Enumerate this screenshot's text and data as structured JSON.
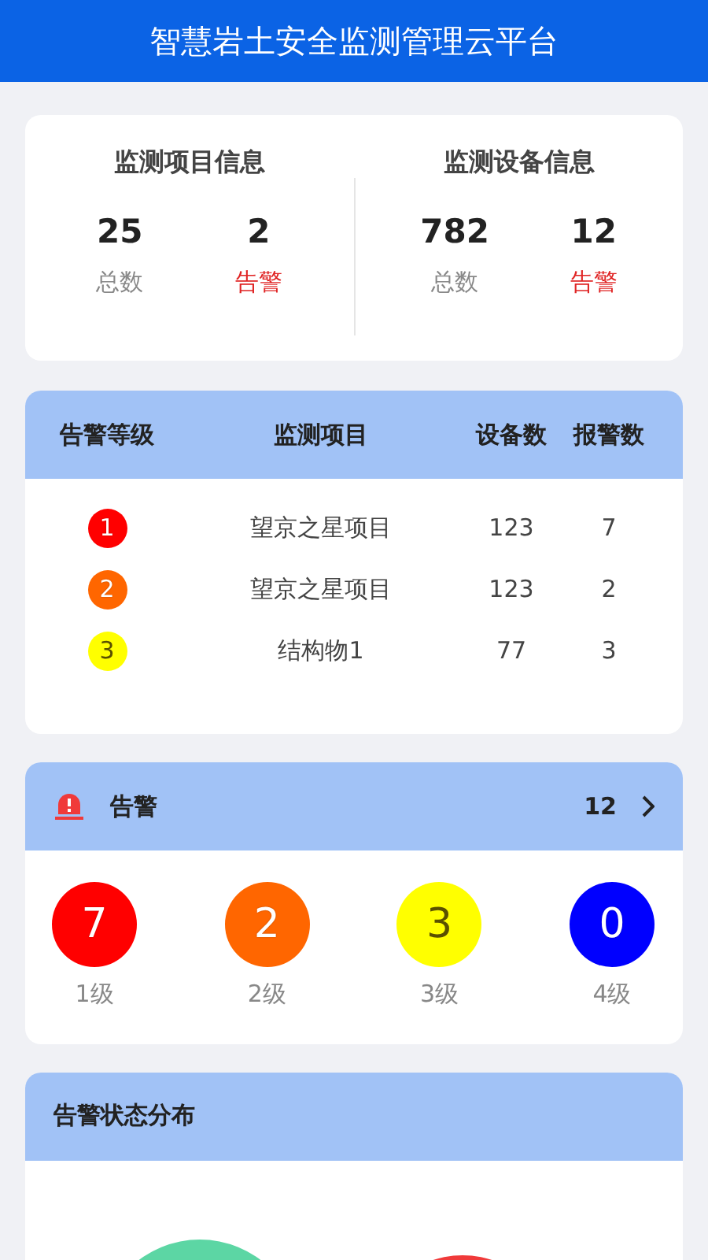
{
  "header": {
    "title": "智慧岩土安全监测管理云平台"
  },
  "summary": [
    {
      "title": "监测项目信息",
      "stats": [
        {
          "value": "25",
          "label": "总数",
          "kind": "total"
        },
        {
          "value": "2",
          "label": "告警",
          "kind": "alarm"
        }
      ]
    },
    {
      "title": "监测设备信息",
      "stats": [
        {
          "value": "782",
          "label": "总数",
          "kind": "total"
        },
        {
          "value": "12",
          "label": "告警",
          "kind": "alarm"
        }
      ]
    }
  ],
  "alarm_table": {
    "columns": [
      "告警等级",
      "监测项目",
      "设备数",
      "报警数"
    ],
    "rows": [
      {
        "level": "1",
        "color": "#ff0000",
        "project": "望京之星项目",
        "devices": "123",
        "alarms": "7"
      },
      {
        "level": "2",
        "color": "#ff6600",
        "project": "望京之星项目",
        "devices": "123",
        "alarms": "2"
      },
      {
        "level": "3",
        "color": "#ffff00",
        "project": "结构物1",
        "devices": "77",
        "alarms": "3"
      }
    ]
  },
  "alarm_panel": {
    "title": "告警",
    "count": "12",
    "levels": [
      {
        "count": "7",
        "label": "1级",
        "color": "#ff0000"
      },
      {
        "count": "2",
        "label": "2级",
        "color": "#ff6600"
      },
      {
        "count": "3",
        "label": "3级",
        "color": "#ffff00"
      },
      {
        "count": "0",
        "label": "4级",
        "color": "#0000ff"
      }
    ]
  },
  "distribution": {
    "title": "告警状态分布"
  }
}
